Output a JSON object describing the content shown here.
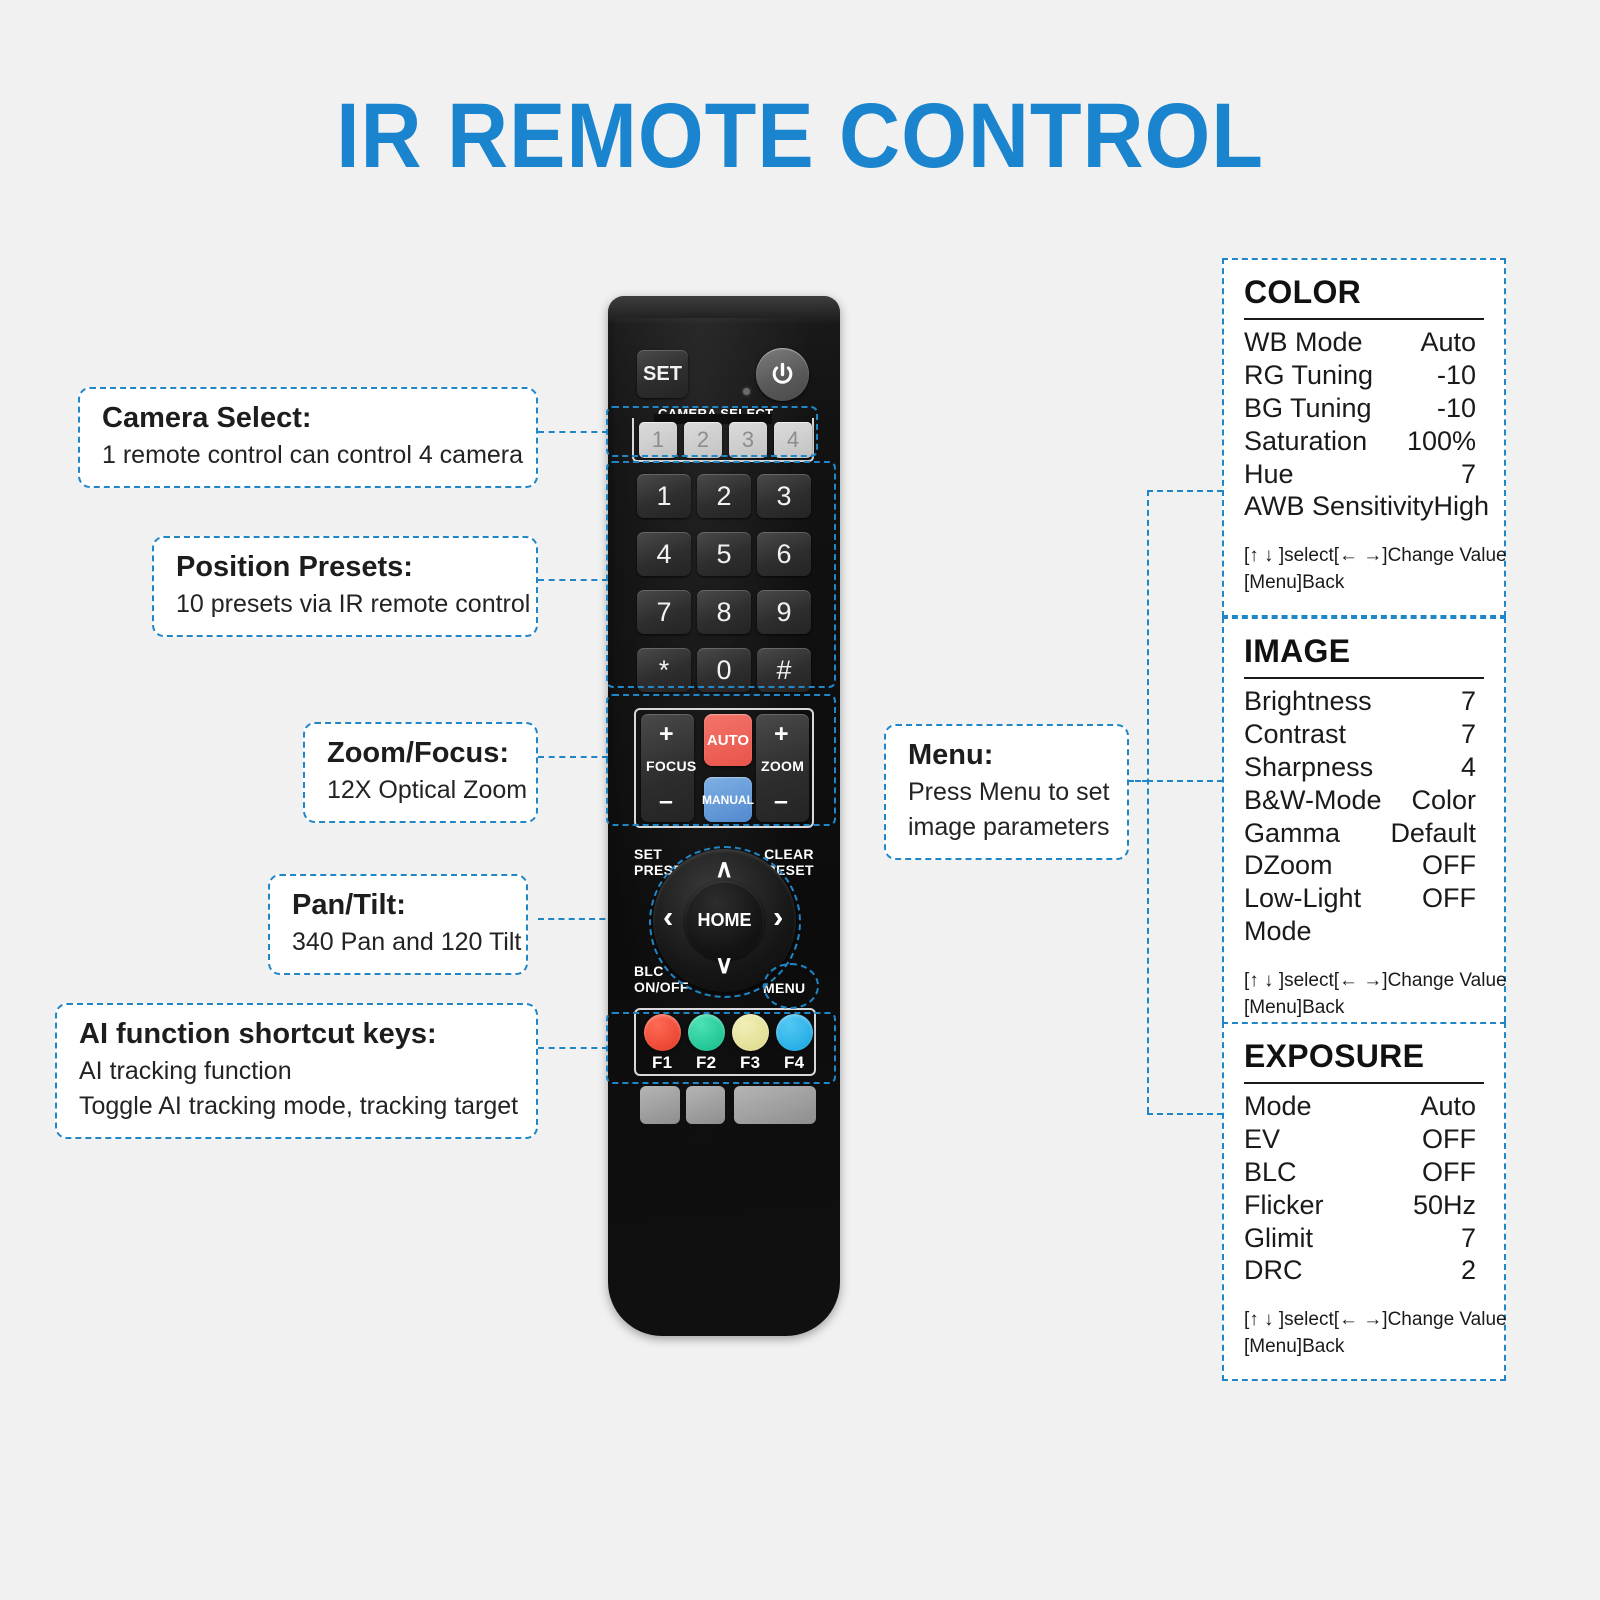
{
  "page": {
    "title": "IR REMOTE CONTROL",
    "accent_color": "#1a84ce",
    "dash_color": "#1f86c8",
    "background_color": "#f1f1f1"
  },
  "callouts": [
    {
      "key": "camera_select",
      "title": "Camera Select:",
      "desc": [
        "1 remote control can control 4 camera"
      ]
    },
    {
      "key": "position_presets",
      "title": "Position Presets:",
      "desc": [
        "10 presets via IR remote control"
      ]
    },
    {
      "key": "zoom_focus",
      "title": "Zoom/Focus:",
      "desc": [
        "12X Optical Zoom"
      ]
    },
    {
      "key": "pan_tilt",
      "title": "Pan/Tilt:",
      "desc": [
        "340 Pan and 120 Tilt"
      ]
    },
    {
      "key": "ai_shortcuts",
      "title": "AI function shortcut keys:",
      "desc": [
        "AI tracking function",
        "Toggle AI tracking mode, tracking target"
      ]
    },
    {
      "key": "menu",
      "title": "Menu:",
      "desc": [
        "Press Menu to set",
        "image parameters"
      ]
    }
  ],
  "panels": [
    {
      "key": "color",
      "title": "COLOR",
      "rows": [
        {
          "label": "WB Mode",
          "value": "Auto"
        },
        {
          "label": "RG Tuning",
          "value": "-10"
        },
        {
          "label": "BG Tuning",
          "value": "-10"
        },
        {
          "label": "Saturation",
          "value": "100%"
        },
        {
          "label": "Hue",
          "value": "7"
        },
        {
          "label": "AWB Sensitivity",
          "value": "High"
        }
      ],
      "hint_line1": "[↑ ↓ ]select[← →]Change Value",
      "hint_line2": "[Menu]Back"
    },
    {
      "key": "image",
      "title": "IMAGE",
      "rows": [
        {
          "label": "Brightness",
          "value": "7"
        },
        {
          "label": "Contrast",
          "value": "7"
        },
        {
          "label": "Sharpness",
          "value": "4"
        },
        {
          "label": "B&W-Mode",
          "value": "Color"
        },
        {
          "label": "Gamma",
          "value": "Default"
        },
        {
          "label": "DZoom",
          "value": "OFF"
        },
        {
          "label": "Low-Light",
          "value": "OFF"
        },
        {
          "label": "Mode",
          "value": ""
        }
      ],
      "hint_line1": "[↑ ↓ ]select[← →]Change Value",
      "hint_line2": "[Menu]Back"
    },
    {
      "key": "exposure",
      "title": "EXPOSURE",
      "rows": [
        {
          "label": "Mode",
          "value": "Auto"
        },
        {
          "label": "EV",
          "value": "OFF"
        },
        {
          "label": "BLC",
          "value": "OFF"
        },
        {
          "label": "Flicker",
          "value": "50Hz"
        },
        {
          "label": "Glimit",
          "value": "7"
        },
        {
          "label": "DRC",
          "value": "2"
        }
      ],
      "hint_line1": "[↑ ↓ ]select[← →]Change Value",
      "hint_line2": "[Menu]Back"
    }
  ],
  "remote": {
    "set_button": "SET",
    "power_icon": "power-icon",
    "camera_select_label": "CAMERA SELECT",
    "camera_select_keys": [
      "1",
      "2",
      "3",
      "4"
    ],
    "keypad": [
      "1",
      "2",
      "3",
      "4",
      "5",
      "6",
      "7",
      "8",
      "9",
      "*",
      "0",
      "#"
    ],
    "focus_label": "FOCUS",
    "zoom_label": "ZOOM",
    "focus_plus": "+",
    "focus_minus": "–",
    "zoom_plus": "+",
    "zoom_minus": "–",
    "auto_button": "AUTO",
    "manual_button": "MANUAL",
    "auto_color": "#ef5d54",
    "manual_color": "#5a94d8",
    "set_preset_line1": "SET",
    "set_preset_line2": "PRESET",
    "clear_preset_line1": "CLEAR",
    "clear_preset_line2": "PRESET",
    "home_button": "HOME",
    "arrow_up": "∧",
    "arrow_down": "∨",
    "arrow_left": "‹",
    "arrow_right": "›",
    "blc_line1": "BLC",
    "blc_line2": "ON/OFF",
    "menu_button": "MENU",
    "f_keys": [
      {
        "label": "F1",
        "color": "#ef4635"
      },
      {
        "label": "F2",
        "color": "#25c898"
      },
      {
        "label": "F3",
        "color": "#e6e49b"
      },
      {
        "label": "F4",
        "color": "#29b3ea"
      }
    ]
  }
}
